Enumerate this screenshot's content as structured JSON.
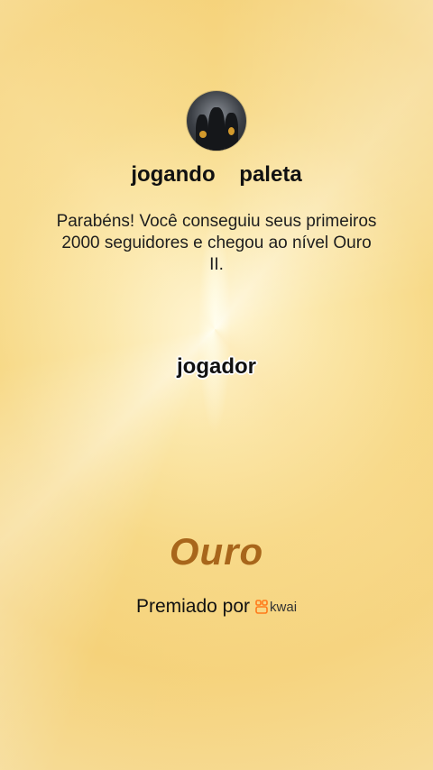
{
  "profile": {
    "username": "jogando    paleta"
  },
  "message": "Parabéns! Você conseguiu seus primeiros 2000 seguidores e chegou ao nível Ouro II.",
  "badge": {
    "label": "jogador",
    "level_title": "Ouro"
  },
  "awarded": {
    "text": "Premiado por",
    "brand": "kwai",
    "brand_icon": "kwai-logo-icon",
    "brand_color": "#ff7a1a"
  },
  "colors": {
    "background": "#f7d987",
    "level_text": "#a8661b"
  }
}
